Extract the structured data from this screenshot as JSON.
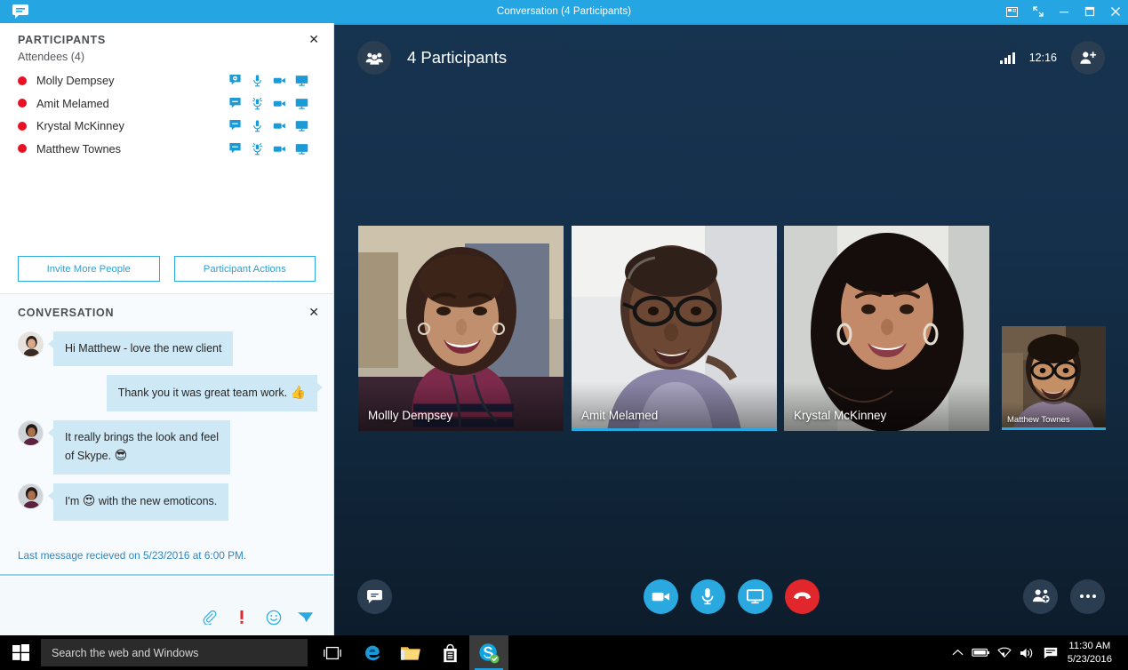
{
  "window": {
    "title": "Conversation (4 Participants)",
    "logo_icon": "skype-chat-bubble-icon",
    "controls": {
      "snap_label": "⧉",
      "restore_down_label": "⤡",
      "minimize_label": "—",
      "maximize_label": "❐",
      "close_label": "✕"
    },
    "accent_color": "#25a6e3"
  },
  "participants_panel": {
    "title": "PARTICIPANTS",
    "close_label": "✕",
    "attendees_label": "Attendees (4)",
    "status_color": "#e81123",
    "icon_color": "#1a9ad7",
    "people": [
      {
        "name": "Molly Dempsey",
        "status": "busy",
        "im": "im-icon",
        "audio": "mic-on-icon",
        "video": "video-icon",
        "share": "screen-share-icon"
      },
      {
        "name": "Amit Melamed",
        "status": "busy",
        "im": "im-icon",
        "audio": "mic-muted-icon",
        "video": "video-icon",
        "share": "screen-share-icon"
      },
      {
        "name": "Krystal McKinney",
        "status": "busy",
        "im": "im-icon",
        "audio": "mic-on-icon",
        "video": "video-icon",
        "share": "screen-share-icon"
      },
      {
        "name": "Matthew Townes",
        "status": "busy",
        "im": "im-icon",
        "audio": "mic-muted-icon",
        "video": "video-icon",
        "share": "screen-share-icon"
      }
    ],
    "invite_button": "Invite More People",
    "actions_button": "Participant Actions"
  },
  "conversation_panel": {
    "title": "CONVERSATION",
    "close_label": "✕",
    "messages": [
      {
        "direction": "in",
        "text": "Hi Matthew - love the new client",
        "emoji": "",
        "avatar": "avatar-krystal"
      },
      {
        "direction": "out",
        "text": "Thank you   it was great team work.",
        "emoji": "👍",
        "avatar": ""
      },
      {
        "direction": "in",
        "text": "It really brings the look and feel",
        "text2": "of Skype.",
        "emoji": "😎",
        "avatar": "avatar-molly"
      },
      {
        "direction": "in",
        "text": "I'm",
        "text2": "with the new emoticons.",
        "emoji": "😍",
        "avatar": "avatar-molly"
      }
    ],
    "note": "Last message recieved on 5/23/2016 at 6:00 PM.",
    "compose_tools": [
      {
        "name": "attach-file-icon",
        "label": "attach"
      },
      {
        "name": "high-importance-icon",
        "label": "!"
      },
      {
        "name": "emoticon-icon",
        "label": "emoticon"
      },
      {
        "name": "send-icon",
        "label": "send"
      }
    ]
  },
  "stage": {
    "header": {
      "roster_icon": "people-group-icon",
      "title": "4 Participants",
      "signal_icon": "signal-strength-icon",
      "clock": "12:16",
      "add_people_icon": "add-participant-icon"
    },
    "tiles": [
      {
        "name": "Mollly Dempsey",
        "speaking": false,
        "size": "large"
      },
      {
        "name": "Amit Melamed",
        "speaking": true,
        "size": "large"
      },
      {
        "name": "Krystal McKinney",
        "speaking": false,
        "size": "large"
      },
      {
        "name": "Matthew Townes",
        "speaking": true,
        "size": "small"
      }
    ],
    "controls": {
      "im_label": "im-icon",
      "video_label": "video-camera-icon",
      "mic_label": "microphone-icon",
      "present_label": "present-screen-icon",
      "hangup_label": "end-call-icon",
      "manage_label": "manage-participants-icon",
      "more_label": "more-options-icon"
    },
    "colors": {
      "blue": "#2aa9e0",
      "red": "#e1262c",
      "dark": "#2b3e51"
    }
  },
  "taskbar": {
    "start_icon": "windows-start-icon",
    "search_placeholder": "Search the web and Windows",
    "pinned": [
      {
        "name": "task-view-icon"
      },
      {
        "name": "edge-browser-icon"
      },
      {
        "name": "file-explorer-icon"
      },
      {
        "name": "store-icon"
      },
      {
        "name": "skype-for-business-icon"
      }
    ],
    "tray": [
      {
        "name": "show-hidden-icons-icon"
      },
      {
        "name": "battery-icon"
      },
      {
        "name": "wifi-icon"
      },
      {
        "name": "volume-icon"
      },
      {
        "name": "action-center-icon"
      }
    ],
    "time": "11:30 AM",
    "date": "5/23/2016"
  }
}
